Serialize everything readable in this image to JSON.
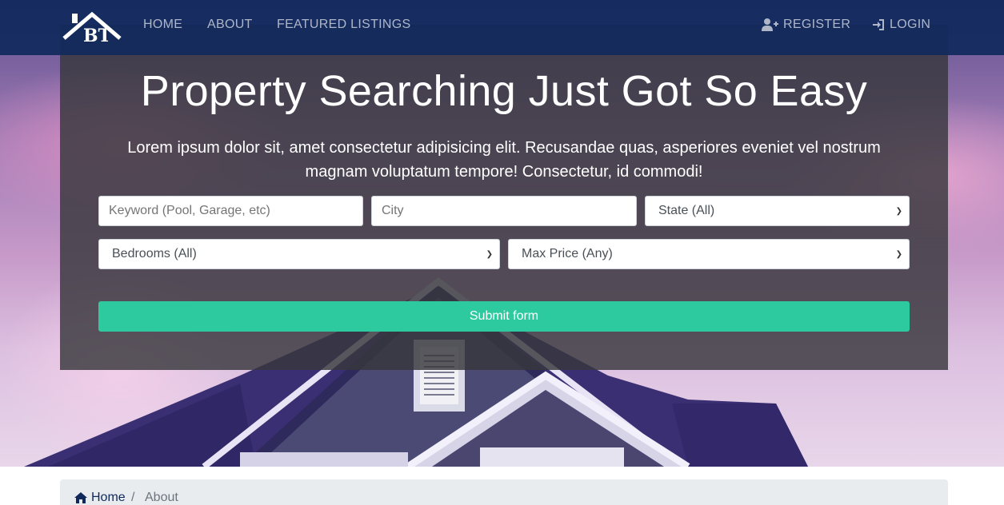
{
  "nav": {
    "logo_text": "BT",
    "links": [
      {
        "label": "HOME"
      },
      {
        "label": "ABOUT"
      },
      {
        "label": "FEATURED LISTINGS"
      }
    ],
    "register_label": "REGISTER",
    "login_label": "LOGIN"
  },
  "hero": {
    "title": "Property Searching Just Got So Easy",
    "lead": "Lorem ipsum dolor sit, amet consectetur adipisicing elit. Recusandae quas, asperiores eveniet vel nostrum magnam voluptatum tempore! Consectetur, id commodi!"
  },
  "search": {
    "keyword_placeholder": "Keyword (Pool, Garage, etc)",
    "city_placeholder": "City",
    "state_selected": "State (All)",
    "bedrooms_selected": "Bedrooms (All)",
    "max_price_selected": "Max Price (Any)",
    "submit_label": "Submit form"
  },
  "breadcrumb": {
    "home_label": "Home",
    "separator": "/",
    "current_label": "About"
  },
  "colors": {
    "navbar": "#10295c",
    "accent": "#2dc99f",
    "overlay": "#37373c"
  }
}
